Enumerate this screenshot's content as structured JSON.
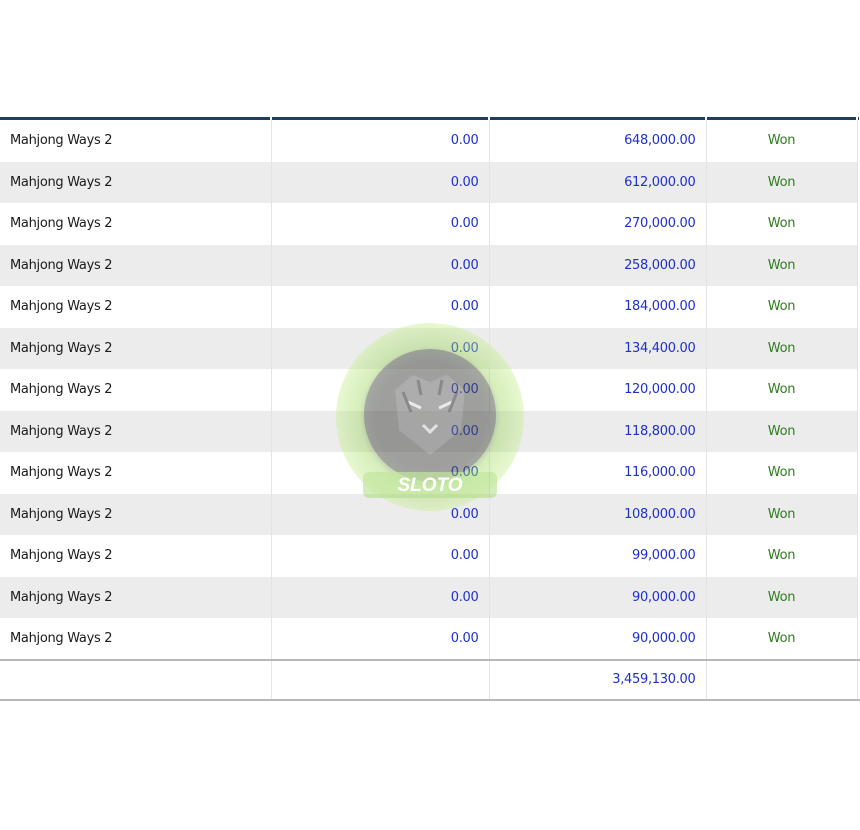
{
  "rows": [
    {
      "game": "Mahjong Ways 2",
      "bet": "0.00",
      "win": "648,000.00",
      "status": "Won"
    },
    {
      "game": "Mahjong Ways 2",
      "bet": "0.00",
      "win": "612,000.00",
      "status": "Won"
    },
    {
      "game": "Mahjong Ways 2",
      "bet": "0.00",
      "win": "270,000.00",
      "status": "Won"
    },
    {
      "game": "Mahjong Ways 2",
      "bet": "0.00",
      "win": "258,000.00",
      "status": "Won"
    },
    {
      "game": "Mahjong Ways 2",
      "bet": "0.00",
      "win": "184,000.00",
      "status": "Won"
    },
    {
      "game": "Mahjong Ways 2",
      "bet": "0.00",
      "win": "134,400.00",
      "status": "Won"
    },
    {
      "game": "Mahjong Ways 2",
      "bet": "0.00",
      "win": "120,000.00",
      "status": "Won"
    },
    {
      "game": "Mahjong Ways 2",
      "bet": "0.00",
      "win": "118,800.00",
      "status": "Won"
    },
    {
      "game": "Mahjong Ways 2",
      "bet": "0.00",
      "win": "116,000.00",
      "status": "Won"
    },
    {
      "game": "Mahjong Ways 2",
      "bet": "0.00",
      "win": "108,000.00",
      "status": "Won"
    },
    {
      "game": "Mahjong Ways 2",
      "bet": "0.00",
      "win": "99,000.00",
      "status": "Won"
    },
    {
      "game": "Mahjong Ways 2",
      "bet": "0.00",
      "win": "90,000.00",
      "status": "Won"
    },
    {
      "game": "Mahjong Ways 2",
      "bet": "0.00",
      "win": "90,000.00",
      "status": "Won"
    }
  ],
  "footer": {
    "total_win": "3,459,130.00"
  },
  "watermark": {
    "text": "SLOTO",
    "icon": "tiger-logo-icon"
  },
  "colors": {
    "header_bar": "#1f3f5f",
    "row_alt": "#ececec",
    "number_text": "#1f2fd0",
    "status_won": "#2e7d1e"
  }
}
